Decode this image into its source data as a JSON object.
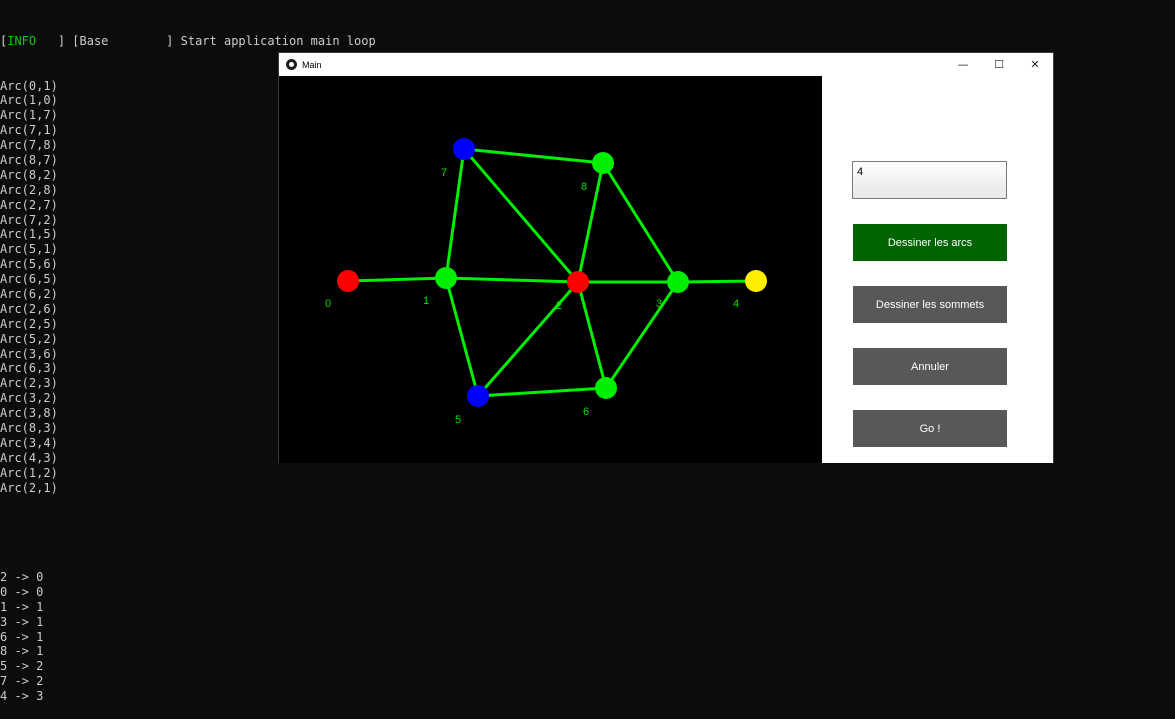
{
  "console": {
    "header": {
      "tag": "INFO",
      "tag_suffix": "   ] [Base        ] Start application main loop",
      "tag_prefix": "["
    },
    "arcs": [
      "Arc(0,1)",
      "Arc(1,0)",
      "Arc(1,7)",
      "Arc(7,1)",
      "Arc(7,8)",
      "Arc(8,7)",
      "Arc(8,2)",
      "Arc(2,8)",
      "Arc(2,7)",
      "Arc(7,2)",
      "Arc(1,5)",
      "Arc(5,1)",
      "Arc(5,6)",
      "Arc(6,5)",
      "Arc(6,2)",
      "Arc(2,6)",
      "Arc(2,5)",
      "Arc(5,2)",
      "Arc(3,6)",
      "Arc(6,3)",
      "Arc(2,3)",
      "Arc(3,2)",
      "Arc(3,8)",
      "Arc(8,3)",
      "Arc(3,4)",
      "Arc(4,3)",
      "Arc(1,2)",
      "Arc(2,1)"
    ],
    "results": [
      "2 -> 0",
      "0 -> 0",
      "1 -> 1",
      "3 -> 1",
      "6 -> 1",
      "8 -> 1",
      "5 -> 2",
      "7 -> 2",
      "4 -> 3"
    ]
  },
  "window": {
    "title": "Main",
    "controls": {
      "minimize": "—",
      "maximize": "☐",
      "close": "✕"
    }
  },
  "graph": {
    "colors": {
      "edge": "#00ee00",
      "canvas_bg": "#000000",
      "label": "#00e000"
    },
    "nodes": [
      {
        "id": "0",
        "color": "#ff0000"
      },
      {
        "id": "1",
        "color": "#00ee00"
      },
      {
        "id": "2",
        "color": "#ff0000"
      },
      {
        "id": "3",
        "color": "#00ee00"
      },
      {
        "id": "4",
        "color": "#ffee00"
      },
      {
        "id": "5",
        "color": "#0000ff"
      },
      {
        "id": "6",
        "color": "#00ee00"
      },
      {
        "id": "7",
        "color": "#0000ff"
      },
      {
        "id": "8",
        "color": "#00ee00"
      }
    ],
    "edges": [
      [
        "0",
        "1"
      ],
      [
        "1",
        "7"
      ],
      [
        "7",
        "8"
      ],
      [
        "8",
        "2"
      ],
      [
        "2",
        "7"
      ],
      [
        "1",
        "5"
      ],
      [
        "5",
        "6"
      ],
      [
        "6",
        "2"
      ],
      [
        "2",
        "5"
      ],
      [
        "3",
        "6"
      ],
      [
        "2",
        "3"
      ],
      [
        "3",
        "8"
      ],
      [
        "3",
        "4"
      ],
      [
        "1",
        "2"
      ]
    ]
  },
  "panel": {
    "input_value": "4",
    "buttons": {
      "draw_arcs": "Dessiner les arcs",
      "draw_vertices": "Dessiner les sommets",
      "cancel": "Annuler",
      "go": "Go !"
    },
    "colors": {
      "active_button": "#006400",
      "button": "#585858"
    }
  }
}
